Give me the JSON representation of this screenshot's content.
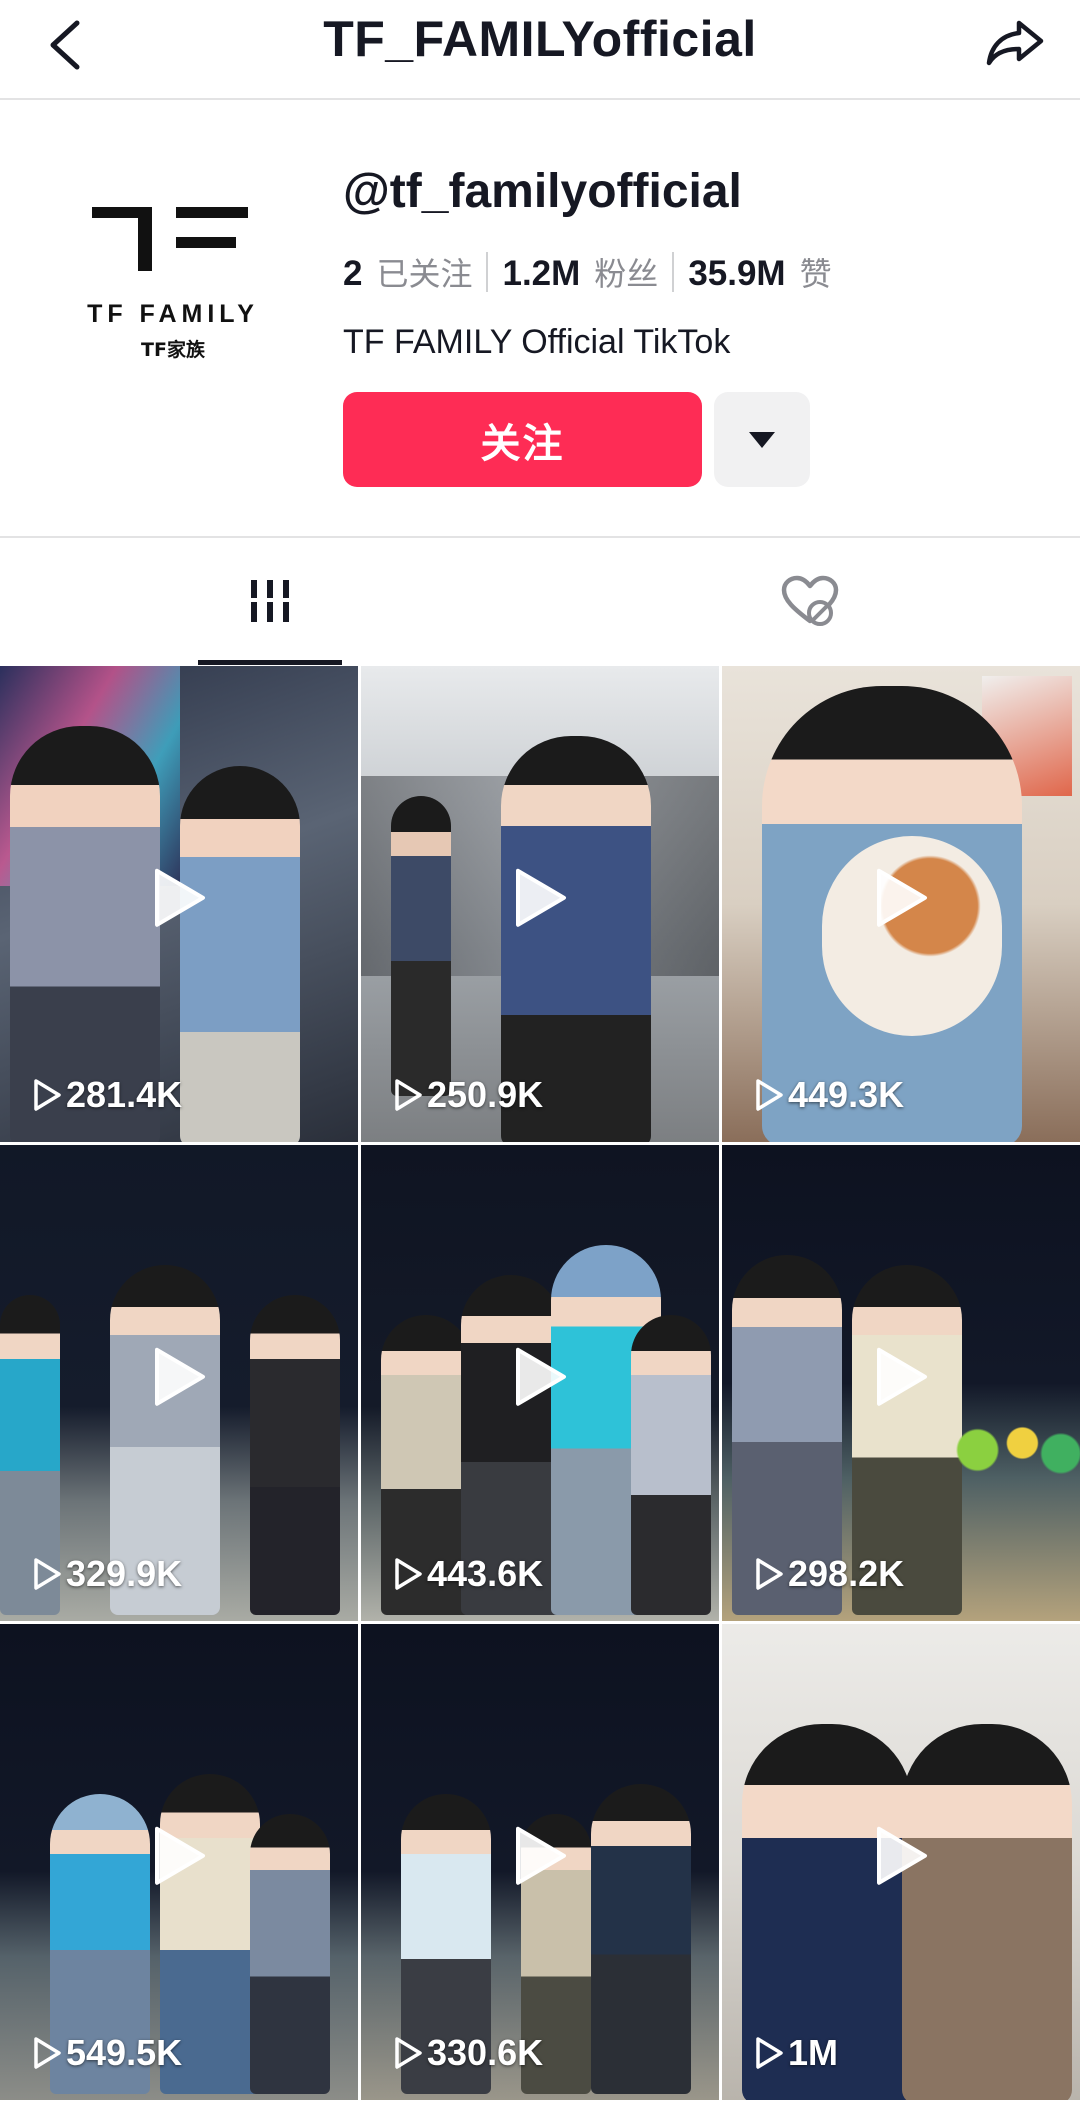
{
  "header": {
    "title": "TF_FAMILYofficial",
    "back_icon": "chevron-left-icon",
    "share_icon": "share-arrow-icon"
  },
  "profile": {
    "avatar_logo": {
      "mark": "TF",
      "line1": "TF FAMILY",
      "line2": "TF家族"
    },
    "handle": "@tf_familyofficial",
    "stats": [
      {
        "value": "2",
        "label": "已关注"
      },
      {
        "value": "1.2M",
        "label": "粉丝"
      },
      {
        "value": "35.9M",
        "label": "赞"
      }
    ],
    "bio": "TF FAMILY Official TikTok",
    "follow_label": "关注",
    "more_icon": "caret-down-icon"
  },
  "tabs": {
    "videos_icon": "grid-lines-icon",
    "liked_icon": "heart-hidden-icon",
    "active": "videos"
  },
  "colors": {
    "accent": "#fe2c55",
    "text": "#161823",
    "muted": "#8a8b91"
  },
  "videos": [
    {
      "views": "281.4K"
    },
    {
      "views": "250.9K"
    },
    {
      "views": "449.3K"
    },
    {
      "views": "329.9K"
    },
    {
      "views": "443.6K"
    },
    {
      "views": "298.2K"
    },
    {
      "views": "549.5K"
    },
    {
      "views": "330.6K"
    },
    {
      "views": "1M"
    }
  ]
}
